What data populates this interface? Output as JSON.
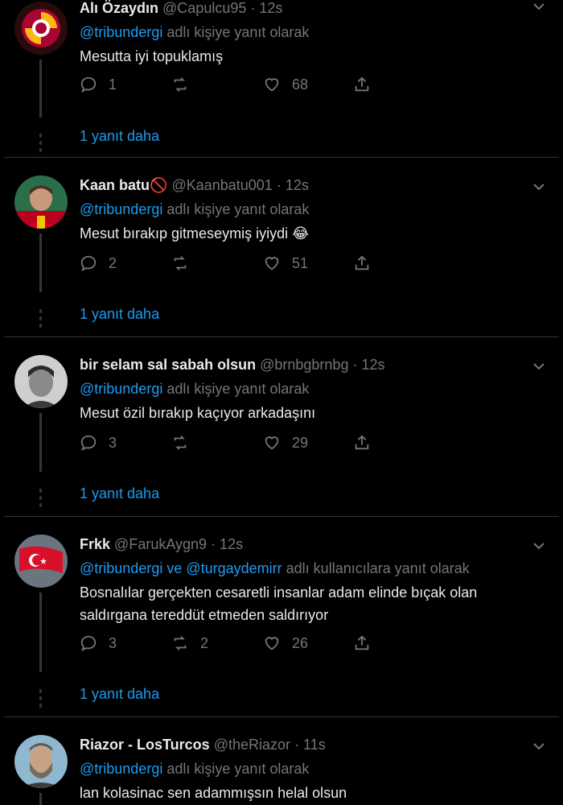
{
  "feed": {
    "tweets": [
      {
        "name": "Alı Özaydın",
        "handle": "@Capulcu95",
        "time": "· 12s",
        "reply_to": "@tribundergi",
        "reply_label": "adlı kişiye yanıt olarak",
        "text": "Mesutta iyi topuklamış",
        "replies": "1",
        "retweets": "",
        "likes": "68",
        "more": "1 yanıt daha",
        "avatar": "galatasaray-crest"
      },
      {
        "name": "Kaan batu🚫",
        "handle": "@Kaanbatu001",
        "time": "· 12s",
        "reply_to": "@tribundergi",
        "reply_label": "adlı kişiye yanıt olarak",
        "text": "Mesut bırakıp gitmeseymiş iyiydi 😂",
        "replies": "2",
        "retweets": "",
        "likes": "51",
        "more": "1 yanıt daha",
        "avatar": "player-photo"
      },
      {
        "name": "bir selam sal sabah olsun",
        "handle": "@brnbgbrnbg",
        "time": "· 12s",
        "reply_to": "@tribundergi",
        "reply_label": "adlı kişiye yanıt olarak",
        "text": "Mesut özil bırakıp kaçıyor arkadaşını",
        "replies": "3",
        "retweets": "",
        "likes": "29",
        "more": "1 yanıt daha",
        "avatar": "bw-portrait"
      },
      {
        "name": "Frkk",
        "handle": "@FarukAygn9",
        "time": "· 12s",
        "reply_to": "@tribundergi ve @turgaydemirr",
        "reply_label": "adlı kullanıcılara yanıt olarak",
        "text": "Bosnalılar gerçekten cesaretli insanlar adam elinde bıçak olan saldırgana tereddüt etmeden saldırıyor",
        "replies": "3",
        "retweets": "2",
        "likes": "26",
        "more": "1 yanıt daha",
        "avatar": "turkish-flag"
      },
      {
        "name": "Riazor - LosTurcos",
        "handle": "@theRiazor",
        "time": "· 11s",
        "reply_to": "@tribundergi",
        "reply_label": "adlı kişiye yanıt olarak",
        "text": "lan kolasinac sen adammışsın helal olsun",
        "replies": "",
        "retweets": "",
        "likes": "",
        "more": "",
        "avatar": "bearded-man"
      }
    ]
  },
  "colors": {
    "background": "#000000",
    "text": "#e7e9ea",
    "muted": "#71767b",
    "link": "#1d9bf0",
    "border": "#2f3336"
  }
}
